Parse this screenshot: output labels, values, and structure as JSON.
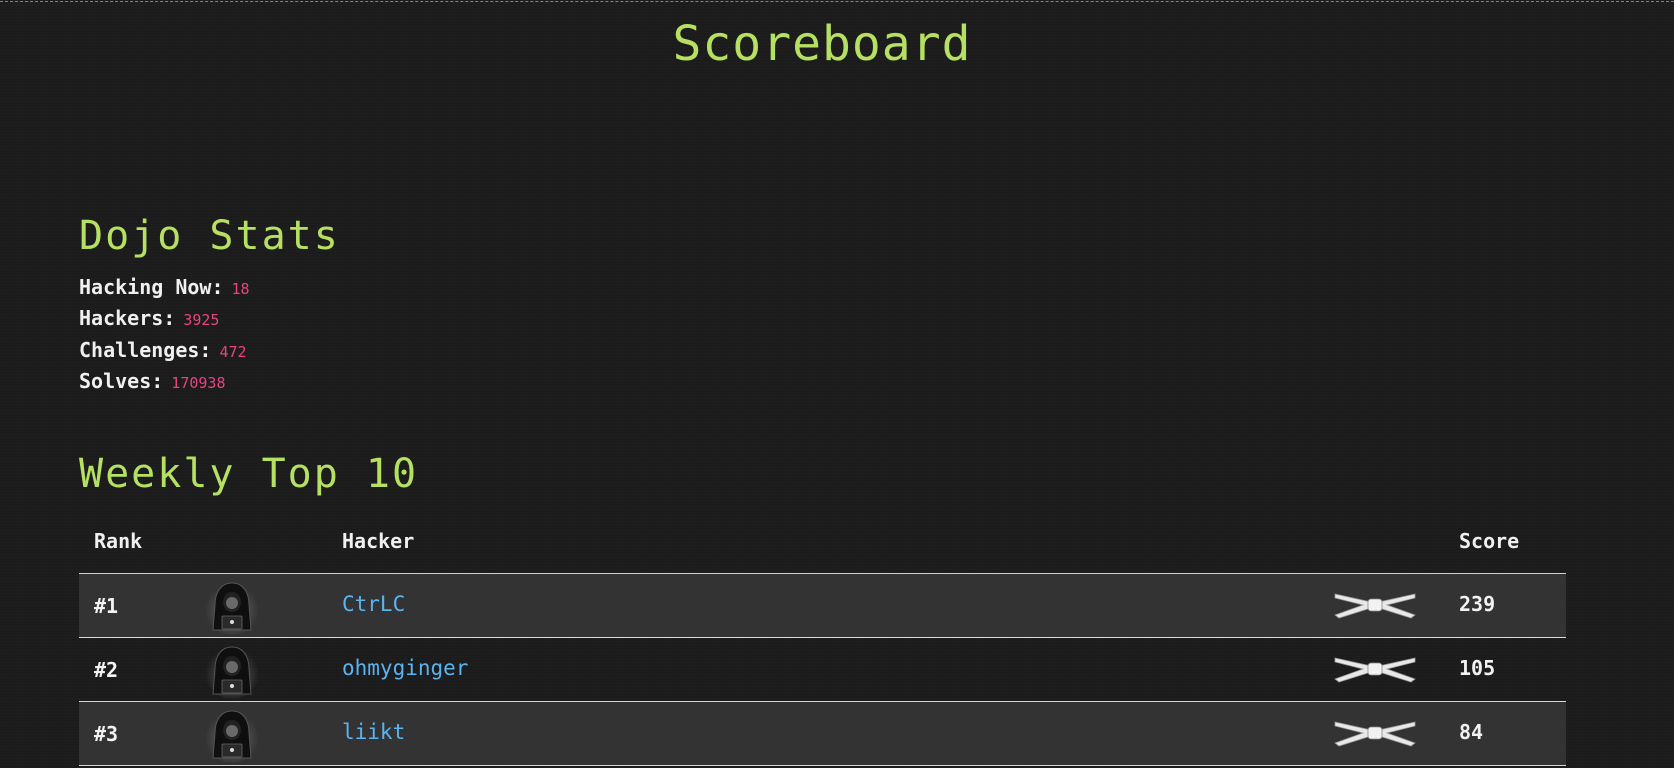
{
  "page": {
    "title": "Scoreboard"
  },
  "dojo_stats": {
    "heading": "Dojo Stats",
    "items": [
      {
        "label": "Hacking Now:",
        "value": "18"
      },
      {
        "label": "Hackers:",
        "value": "3925"
      },
      {
        "label": "Challenges:",
        "value": "472"
      },
      {
        "label": "Solves:",
        "value": "170938"
      }
    ]
  },
  "weekly_top": {
    "heading": "Weekly Top 10",
    "columns": {
      "rank": "Rank",
      "hacker": "Hacker",
      "score": "Score"
    },
    "rows": [
      {
        "rank": "#1",
        "hacker": "CtrLC",
        "score": "239",
        "avatar_icon": "hooded-hacker-icon",
        "belt_icon": "white-belt-icon"
      },
      {
        "rank": "#2",
        "hacker": "ohmyginger",
        "score": "105",
        "avatar_icon": "hooded-hacker-icon",
        "belt_icon": "white-belt-icon"
      },
      {
        "rank": "#3",
        "hacker": "liikt",
        "score": "84",
        "avatar_icon": "hooded-hacker-icon",
        "belt_icon": "white-belt-icon"
      }
    ]
  },
  "colors": {
    "background": "#1c1c1c",
    "heading": "#b5e061",
    "stat_value": "#e64581",
    "link": "#5bb3ef",
    "row_highlight": "#333333"
  }
}
